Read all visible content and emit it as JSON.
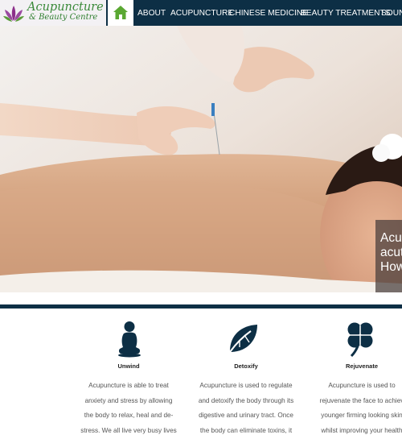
{
  "brand": {
    "line1": "Acupuncture",
    "line2": "& Beauty Centre"
  },
  "nav": {
    "items": [
      {
        "label": "ABOUT"
      },
      {
        "label": "ACUPUNCTURE"
      },
      {
        "label": "CHINESE MEDICINE"
      },
      {
        "label": "BEAUTY TREATMENTS"
      },
      {
        "label": "SOUN"
      }
    ]
  },
  "hero": {
    "caption": {
      "line1": "Acup",
      "line2": "acuti",
      "line3": "How"
    }
  },
  "features": [
    {
      "icon": "meditation-icon",
      "title": "Unwind",
      "lines": [
        "Acupuncture is able to treat",
        "anxiety and stress by allowing",
        "the body to relax, heal and de-",
        "stress. We all live very busy lives"
      ]
    },
    {
      "icon": "leaf-icon",
      "title": "Detoxify",
      "lines": [
        "Acupuncture is used to regulate",
        "and detoxify the body through its",
        "digestive and urinary tract. Once",
        "the body can eliminate toxins, it"
      ]
    },
    {
      "icon": "clover-icon",
      "title": "Rejuvenate",
      "lines": [
        "Acupuncture is used to",
        "rejuvenate the face to achiev",
        "younger firming looking skin",
        "whilst improving your health"
      ]
    }
  ],
  "colors": {
    "navy": "#0d2f45",
    "brand_green": "#3b8a3a",
    "home_green": "#5aa832"
  }
}
